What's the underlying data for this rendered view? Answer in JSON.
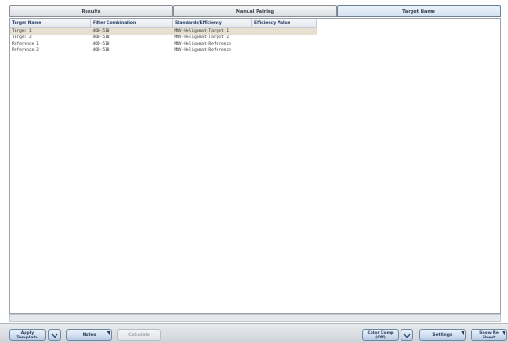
{
  "tabs": [
    {
      "label": "Results",
      "active": false
    },
    {
      "label": "Manual Pairing",
      "active": false
    },
    {
      "label": "Target Name",
      "active": true
    }
  ],
  "table": {
    "columns": [
      "Target Name",
      "Filter Combination",
      "Standards/Efficiency",
      "Efficiency Value"
    ],
    "rows": [
      [
        "Target 1",
        "460-510",
        "MRV-Heligomat-Target 1",
        ""
      ],
      [
        "Target 2",
        "460-510",
        "MRV-Heligomat-Target 2",
        ""
      ],
      [
        "Reference 1",
        "460-510",
        "MRV-Heligomat-Reference",
        ""
      ],
      [
        "Reference 2",
        "460-510",
        "MRV-Heligomat-Reference",
        ""
      ]
    ],
    "selected_row": 0
  },
  "bottom_buttons": {
    "apply_template": "Apply Template",
    "notes": "Notes",
    "calculate": "Calculate",
    "color_comp": "Color Comp (Off)",
    "settings": "Settings",
    "show_hide": "Show Re Sheet"
  },
  "icons": {
    "dropdown": "chevron-down-icon",
    "corner": "corner-menu-icon"
  }
}
